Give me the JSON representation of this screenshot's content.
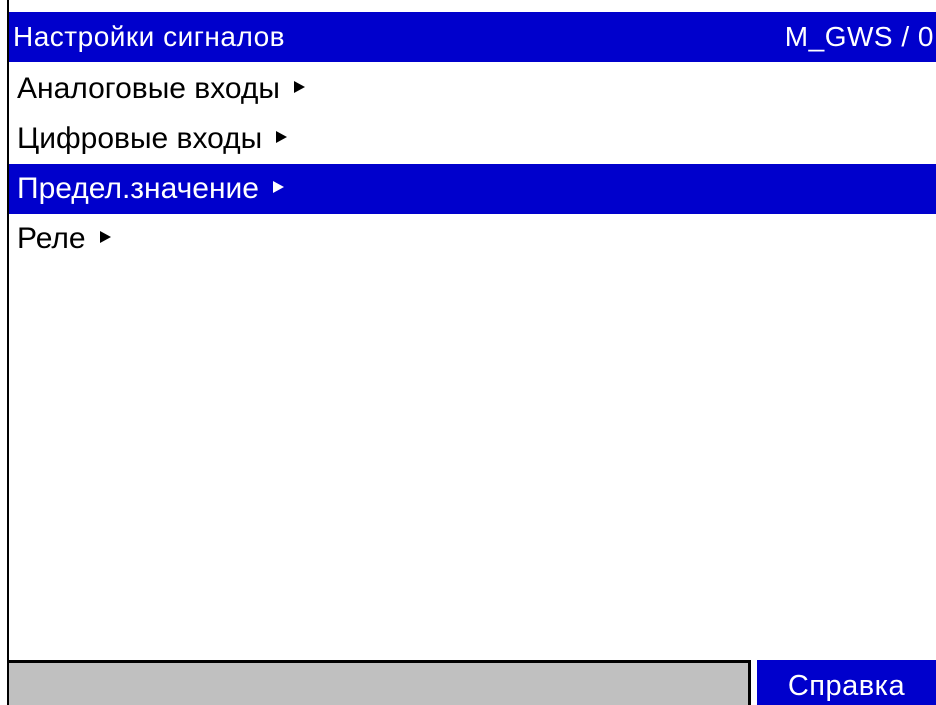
{
  "header": {
    "title": "Настройки сигналов",
    "code": "M_GWS / 0"
  },
  "menu": {
    "items": [
      {
        "label": "Аналоговые входы",
        "icon": "submenu-arrow-icon",
        "selected": false
      },
      {
        "label": "Цифровые входы",
        "icon": "submenu-arrow-icon",
        "selected": false
      },
      {
        "label": "Предел.значение",
        "icon": "submenu-arrow-icon",
        "selected": true
      },
      {
        "label": "Реле",
        "icon": "submenu-arrow-icon",
        "selected": false
      }
    ]
  },
  "footer": {
    "status_text": "",
    "help_label": "Справка"
  },
  "colors": {
    "highlight": "#0000cc",
    "background": "#ffffff",
    "status_field": "#c0c0c0"
  }
}
